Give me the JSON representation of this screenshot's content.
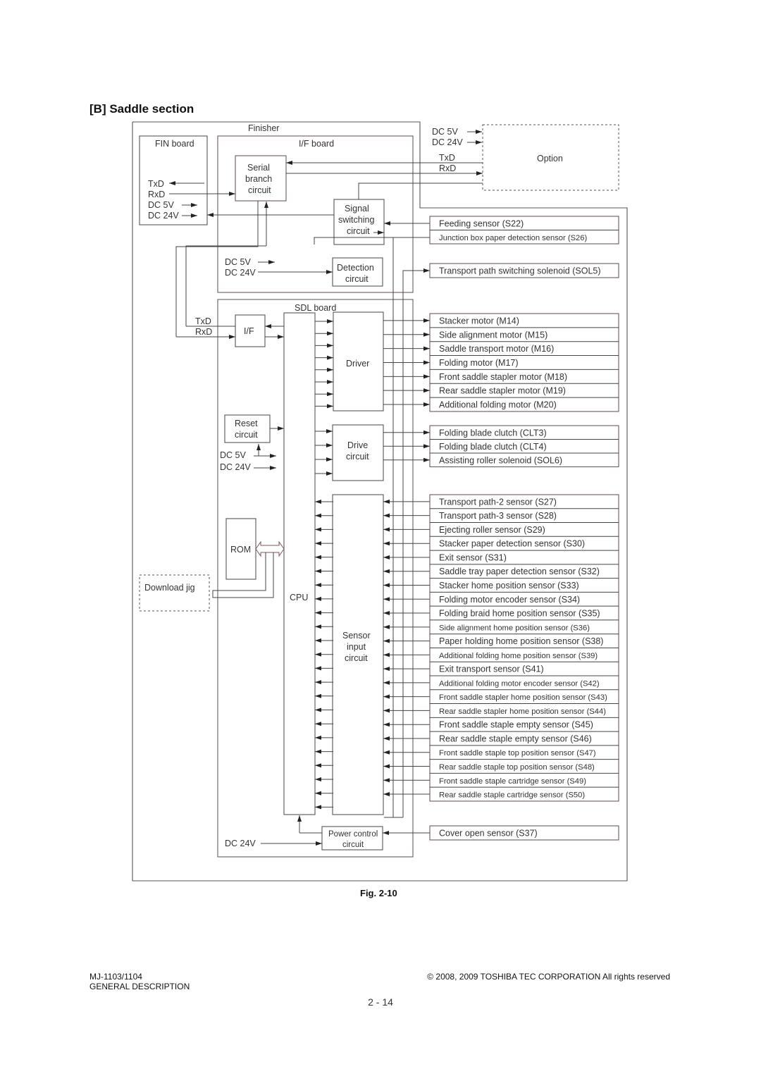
{
  "section_title": "[B]   Saddle section",
  "figure_caption": "Fig. 2-10",
  "footer": {
    "model": "MJ-1103/1104",
    "chapter": "GENERAL DESCRIPTION",
    "copyright": "© 2008, 2009 TOSHIBA TEC CORPORATION All rights reserved",
    "page": "2 - 14"
  },
  "diagram": {
    "finisher": "Finisher",
    "fin_board": {
      "title": "FIN board",
      "txd": "TxD",
      "rxd": "RxD",
      "dc5": "DC 5V",
      "dc24": "DC 24V"
    },
    "if_board": {
      "title": "I/F board",
      "serial": [
        "Serial",
        "branch",
        "circuit"
      ],
      "signal": [
        "Signal",
        "switching",
        "circuit"
      ],
      "detection": [
        "Detection",
        "circuit"
      ],
      "dc5": "DC 5V",
      "dc24": "DC 24V"
    },
    "option": {
      "title": "Option",
      "dc5": "DC 5V",
      "dc24": "DC 24V",
      "txd": "TxD",
      "rxd": "RxD"
    },
    "sdl_board": {
      "title": "SDL board",
      "txd": "TxD",
      "rxd": "RxD",
      "if": "I/F",
      "cpu": "CPU",
      "driver": "Driver",
      "drive": [
        "Drive",
        "circuit"
      ],
      "sensor": [
        "Sensor",
        "input",
        "circuit"
      ],
      "reset": [
        "Reset",
        "circuit"
      ],
      "dc5": "DC 5V",
      "dc24": "DC 24V",
      "rom": "ROM",
      "power": [
        "Power control",
        "circuit"
      ],
      "power_dc24": "DC 24V"
    },
    "download_jig": "Download jig",
    "if_outputs": [
      "Feeding sensor (S22)",
      "Junction box paper detection sensor (S26)"
    ],
    "if_solenoid": [
      "Transport path switching solenoid (SOL5)"
    ],
    "motors": [
      "Stacker motor (M14)",
      "Side alignment motor (M15)",
      "Saddle transport motor (M16)",
      "Folding motor (M17)",
      "Front saddle stapler motor (M18)",
      "Rear saddle stapler motor (M19)",
      "Additional folding motor (M20)"
    ],
    "clutches": [
      "Folding blade clutch (CLT3)",
      "Folding blade clutch (CLT4)",
      "Assisting roller solenoid (SOL6)"
    ],
    "sensors": [
      "Transport path-2 sensor (S27)",
      "Transport path-3 sensor (S28)",
      "Ejecting roller sensor (S29)",
      "Stacker paper detection sensor (S30)",
      "Exit sensor (S31)",
      "Saddle tray paper detection sensor (S32)",
      "Stacker home position sensor (S33)",
      "Folding motor encoder sensor (S34)",
      "Folding braid home position sensor (S35)",
      "Side alignment home position sensor (S36)",
      "Paper holding home position sensor (S38)",
      "Additional folding home position sensor (S39)",
      "Exit transport sensor (S41)",
      "Additional folding motor encoder sensor (S42)",
      "Front saddle stapler home position sensor (S43)",
      "Rear saddle stapler home position sensor (S44)",
      "Front saddle staple empty sensor (S45)",
      "Rear saddle staple empty sensor (S46)",
      "Front saddle staple top position sensor (S47)",
      "Rear saddle staple top position sensor (S48)",
      "Front saddle staple cartridge sensor (S49)",
      "Rear saddle staple cartridge sensor (S50)"
    ],
    "cover": [
      "Cover open sensor (S37)"
    ]
  }
}
